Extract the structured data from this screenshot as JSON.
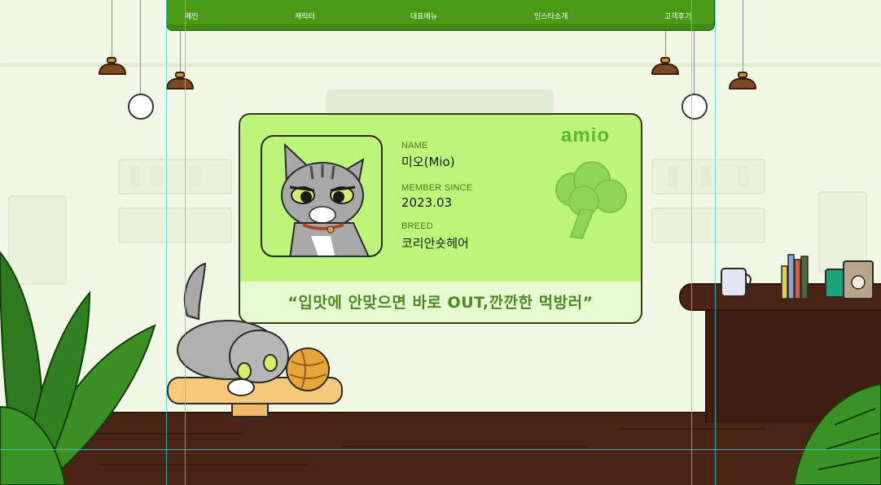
{
  "nav": {
    "items": [
      {
        "label": "메인"
      },
      {
        "label": "캐릭터"
      },
      {
        "label": "대표메뉴"
      },
      {
        "label": "인스타소개"
      },
      {
        "label": "고객후기"
      }
    ]
  },
  "card": {
    "logo": "amio",
    "fields": [
      {
        "label": "NAME",
        "value": "미오(Mio)"
      },
      {
        "label": "MEMBER SINCE",
        "value": "2023.03"
      },
      {
        "label": "BREED",
        "value": "코리안숏헤어"
      }
    ],
    "quote": "“입맛에 안맞으면 바로 OUT,깐깐한 먹방러”"
  },
  "colors": {
    "nav_green": "#4a9a18",
    "card_green": "#bdf57a",
    "accent_green": "#5fb82a",
    "floor_brown": "#4a2515"
  }
}
